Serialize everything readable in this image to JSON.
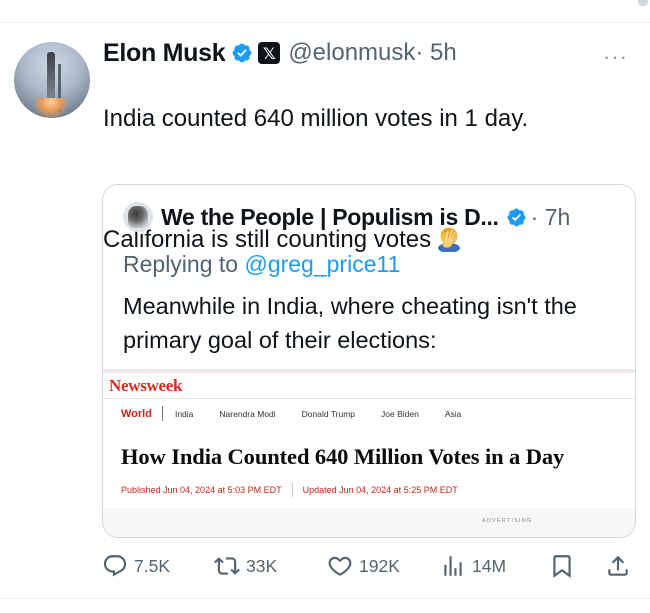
{
  "tweet": {
    "author_name": "Elon Musk",
    "handle": "@elonmusk",
    "time": "· 5h",
    "more_label": "···",
    "text_line1": "India counted 640 million votes in 1 day.",
    "text_line2": "California is still counting votes",
    "emoji_icon": "facepalm-icon",
    "badges": [
      "verified-icon",
      "x-affiliate-icon"
    ]
  },
  "quote": {
    "author_name": "We the People | Populism is D...",
    "time": "· 7h",
    "reply_prefix": "Replying to",
    "reply_mention": "@greg_price11",
    "text": "Meanwhile in India, where cheating isn't the primary goal of their elections:",
    "card": {
      "logo": "Newsweek",
      "section": "World",
      "tags": [
        "India",
        "Narendra Modi",
        "Donald Trump",
        "Joe Biden",
        "Asia"
      ],
      "headline": "How India Counted 640 Million Votes in a Day",
      "published": "Published Jun 04, 2024 at 5:03 PM EDT",
      "updated": "Updated Jun 04, 2024 at 5:25 PM EDT",
      "advertising": "ADVERTISING"
    }
  },
  "actions": {
    "replies": "7.5K",
    "reposts": "33K",
    "likes": "192K",
    "views": "14M"
  },
  "colors": {
    "verified_blue": "#1d9bf0",
    "text": "#0f1419",
    "muted": "#536471",
    "newsweek_red": "#d72b1f"
  }
}
